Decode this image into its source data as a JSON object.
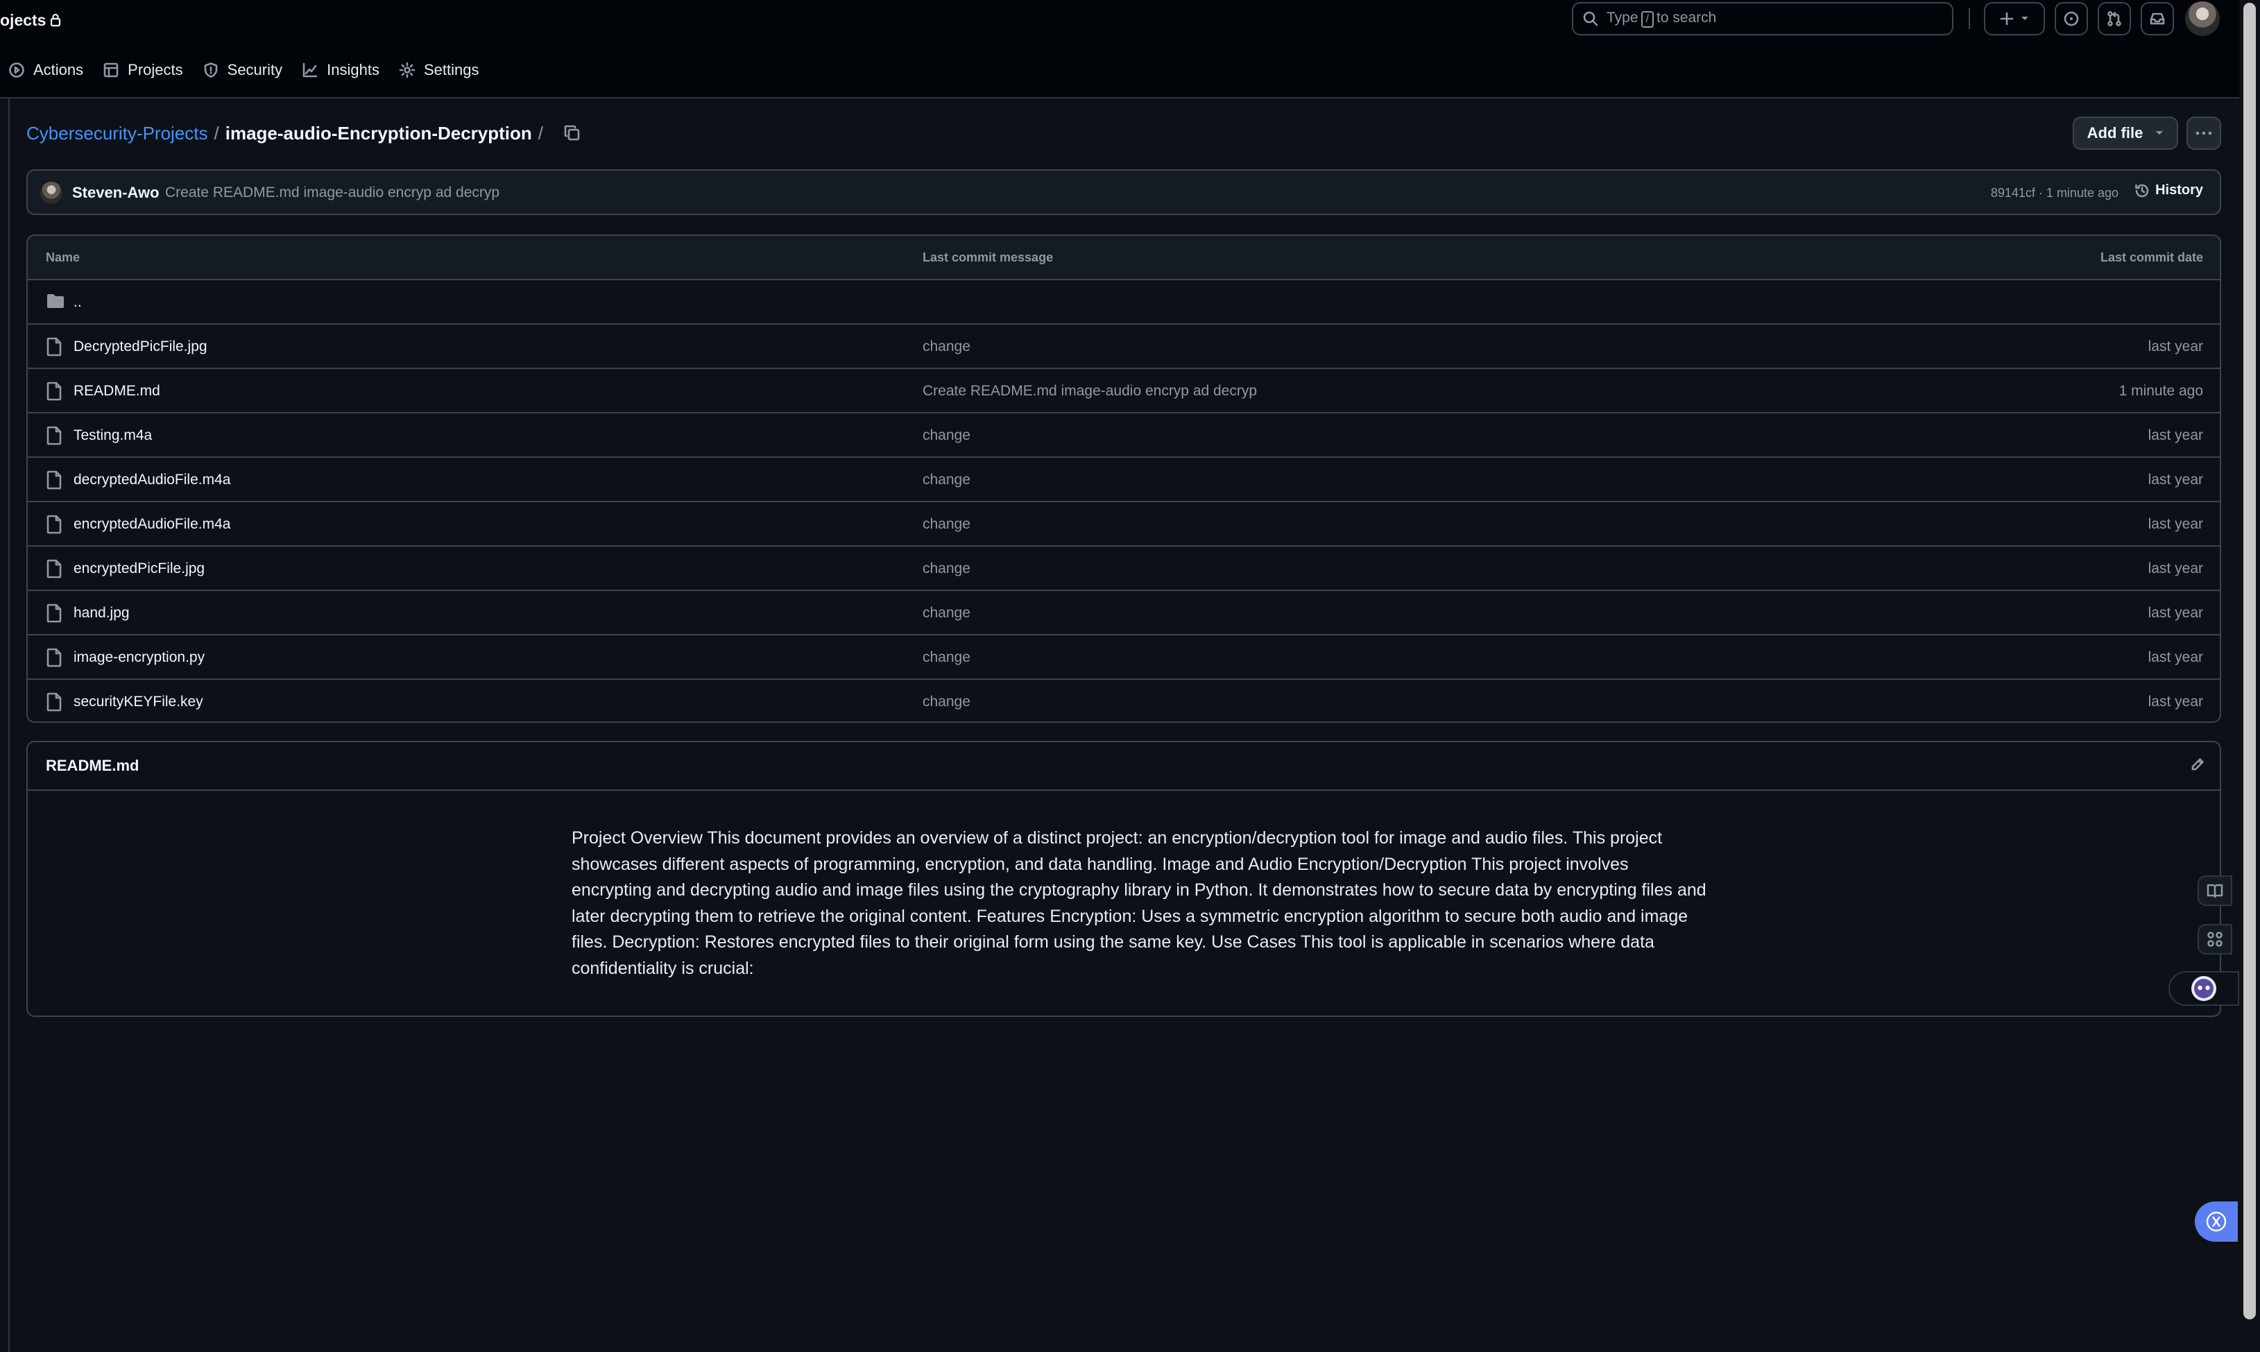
{
  "header": {
    "repo_title": "ojects",
    "search_placeholder_before": "Type",
    "search_key": "/",
    "search_placeholder_after": "to search"
  },
  "repo_nav": [
    {
      "label": "Actions",
      "icon": "play-circle-icon"
    },
    {
      "label": "Projects",
      "icon": "table-icon"
    },
    {
      "label": "Security",
      "icon": "shield-icon"
    },
    {
      "label": "Insights",
      "icon": "graph-icon"
    },
    {
      "label": "Settings",
      "icon": "gear-icon"
    }
  ],
  "breadcrumb": {
    "repo": "Cybersecurity-Projects",
    "sep": "/",
    "dir": "image-audio-Encryption-Decryption"
  },
  "actions": {
    "add_file_label": "Add file"
  },
  "commit": {
    "author": "Steven-Awo",
    "message": "Create README.md image-audio encryp ad decryp",
    "meta": "89141cf · 1 minute ago",
    "history_label": "History"
  },
  "file_table": {
    "headers": {
      "name": "Name",
      "message": "Last commit message",
      "date": "Last commit date"
    },
    "parent": "..",
    "rows": [
      {
        "name": "DecryptedPicFile.jpg",
        "message": "change",
        "date": "last year"
      },
      {
        "name": "README.md",
        "message": "Create README.md image-audio encryp ad decryp",
        "date": "1 minute ago"
      },
      {
        "name": "Testing.m4a",
        "message": "change",
        "date": "last year"
      },
      {
        "name": "decryptedAudioFile.m4a",
        "message": "change",
        "date": "last year"
      },
      {
        "name": "encryptedAudioFile.m4a",
        "message": "change",
        "date": "last year"
      },
      {
        "name": "encryptedPicFile.jpg",
        "message": "change",
        "date": "last year"
      },
      {
        "name": "hand.jpg",
        "message": "change",
        "date": "last year"
      },
      {
        "name": "image-encryption.py",
        "message": "change",
        "date": "last year"
      },
      {
        "name": "securityKEYFile.key",
        "message": "change",
        "date": "last year"
      }
    ]
  },
  "readme": {
    "title": "README.md",
    "body": "Project Overview This document provides an overview of a distinct project: an encryption/decryption tool for image and audio files. This project showcases different aspects of programming, encryption, and data handling. Image and Audio Encryption/Decryption This project involves encrypting and decrypting audio and image files using the cryptography library in Python. It demonstrates how to secure data by encrypting files and later decrypting them to retrieve the original content. Features Encryption: Uses a symmetric encryption algorithm to secure both audio and image files. Decryption: Restores encrypted files to their original form using the same key. Use Cases This tool is applicable in scenarios where data confidentiality is crucial:"
  },
  "colors": {
    "background": "#0d1117",
    "header_bg": "#010409",
    "border": "#3d444d",
    "link": "#4493f8",
    "muted_text": "#9198a1",
    "text": "#e6edf3",
    "extension_blue": "#5b7ff0"
  }
}
